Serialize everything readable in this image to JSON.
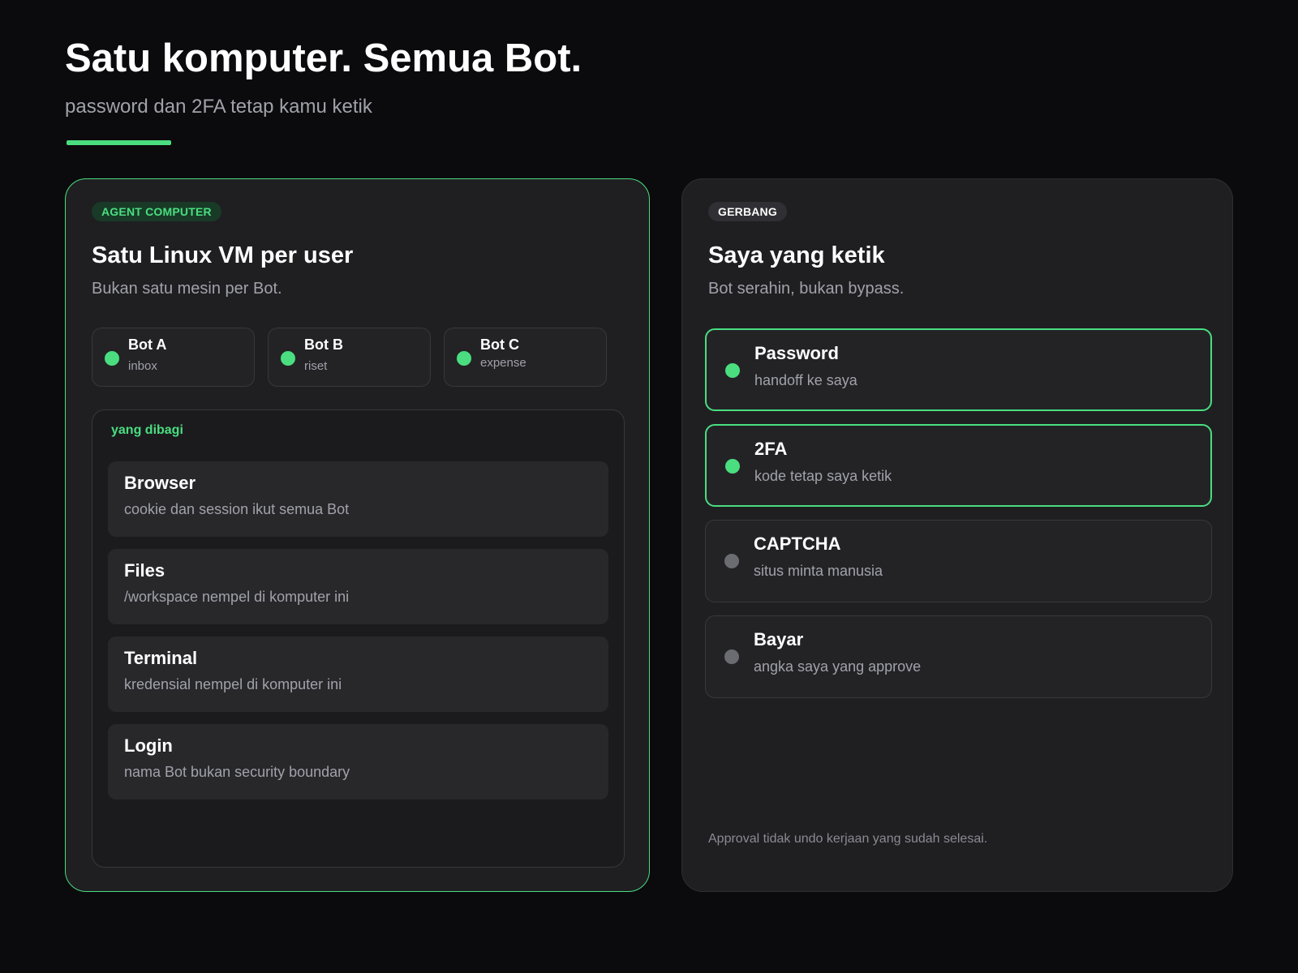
{
  "header": {
    "title": "Satu komputer. Semua Bot.",
    "subtitle": "password dan 2FA tetap kamu ketik"
  },
  "colors": {
    "accent": "#4ade80",
    "background": "#0b0b0d",
    "card": "#1f1f22",
    "inactive_dot": "#6b6b72"
  },
  "left_card": {
    "badge": "AGENT COMPUTER",
    "title": "Satu Linux VM per user",
    "subtitle": "Bukan satu mesin per Bot.",
    "bots": [
      {
        "name": "Bot A",
        "role": "inbox",
        "status": "active"
      },
      {
        "name": "Bot B",
        "role": "riset",
        "status": "active"
      },
      {
        "name": "Bot C",
        "role": "expense",
        "status": "active"
      }
    ],
    "shared": {
      "label": "yang dibagi",
      "items": [
        {
          "title": "Browser",
          "desc": "cookie dan session ikut semua Bot"
        },
        {
          "title": "Files",
          "desc": "/workspace nempel di komputer ini"
        },
        {
          "title": "Terminal",
          "desc": "kredensial nempel di komputer ini"
        },
        {
          "title": "Login",
          "desc": "nama Bot bukan security boundary"
        }
      ]
    }
  },
  "right_card": {
    "badge": "GERBANG",
    "title": "Saya yang ketik",
    "subtitle": "Bot serahin, bukan bypass.",
    "gates": [
      {
        "title": "Password",
        "desc": "handoff ke saya",
        "active": true
      },
      {
        "title": "2FA",
        "desc": "kode tetap saya ketik",
        "active": true
      },
      {
        "title": "CAPTCHA",
        "desc": "situs minta manusia",
        "active": false
      },
      {
        "title": "Bayar",
        "desc": "angka saya yang approve",
        "active": false
      }
    ],
    "footnote": "Approval tidak undo kerjaan yang sudah selesai."
  }
}
